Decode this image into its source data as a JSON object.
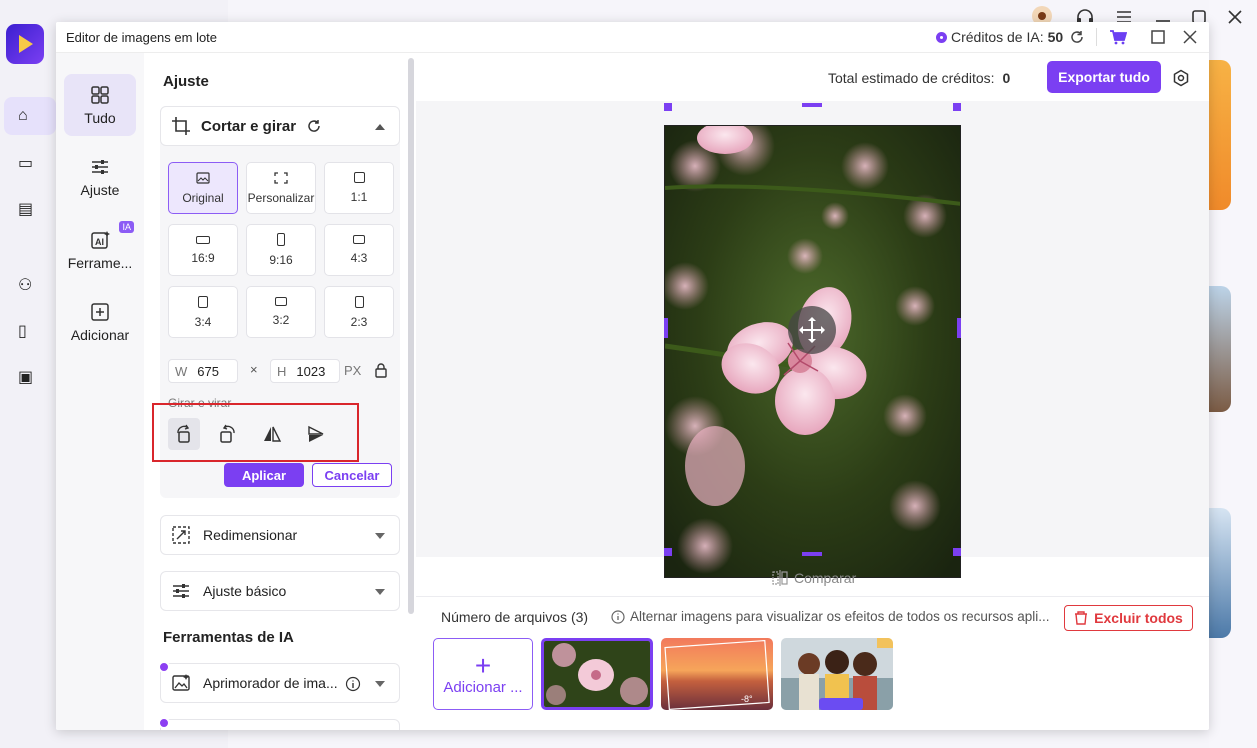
{
  "dialog": {
    "title": "Editor de imagens em lote",
    "credits_label": "Créditos de IA:",
    "credits_value": "50"
  },
  "rail": [
    {
      "label": "Tudo",
      "icon": "grid-icon",
      "active": true
    },
    {
      "label": "Ajuste",
      "icon": "sliders-icon",
      "active": false
    },
    {
      "label": "Ferrame...",
      "icon": "ai-tools-icon",
      "active": false,
      "badge": "IA"
    },
    {
      "label": "Adicionar",
      "icon": "add-square-icon",
      "active": false
    }
  ],
  "panel": {
    "section_title": "Ajuste",
    "crop": {
      "title": "Cortar e girar",
      "ratios": [
        "Original",
        "Personalizar",
        "1:1",
        "16:9",
        "9:16",
        "4:3",
        "3:4",
        "3:2",
        "2:3"
      ],
      "selected_ratio": "Original",
      "width_label": "W",
      "width_value": "675",
      "times": "×",
      "height_label": "H",
      "height_value": "1023",
      "unit": "PX",
      "rotate_label": "Girar e virar",
      "apply_label": "Aplicar",
      "cancel_label": "Cancelar"
    },
    "resize_label": "Redimensionar",
    "basic_label": "Ajuste básico",
    "ai_tools_title": "Ferramentas de IA",
    "enhancer_label": "Aprimorador de ima..."
  },
  "preview": {
    "estimate_label": "Total estimado de créditos:",
    "estimate_value": "0",
    "export_label": "Exportar tudo",
    "compare_label": "Comparar"
  },
  "files": {
    "count_label": "Número de arquivos (3)",
    "hint": "Alternar imagens para visualizar os efeitos de todos os recursos apli...",
    "delete_label": "Excluir todos",
    "add_label": "Adicionar ...",
    "thumbs": [
      {
        "name": "flower",
        "selected": true
      },
      {
        "name": "sunset",
        "selected": false,
        "overlay_text": "-8°"
      },
      {
        "name": "friends",
        "selected": false
      }
    ]
  },
  "colors": {
    "accent": "#7b3ff2",
    "danger": "#e0393e",
    "highlight": "#d9262c"
  }
}
